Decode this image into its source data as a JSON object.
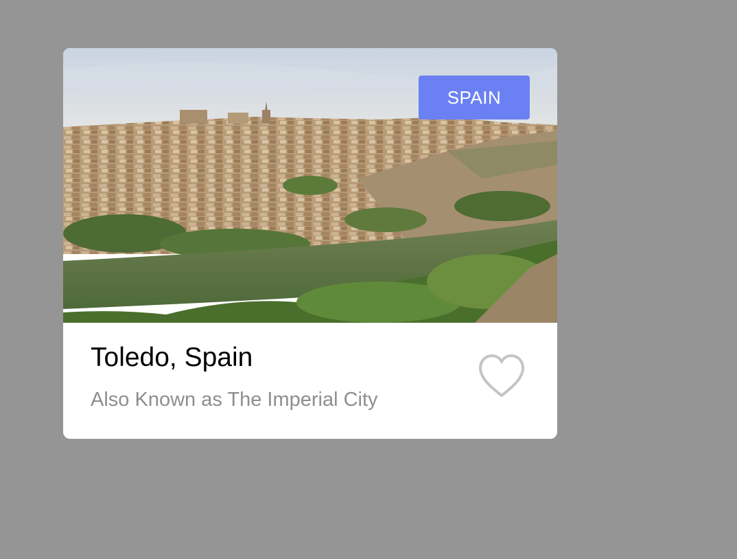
{
  "card": {
    "badge": "SPAIN",
    "title": "Toledo, Spain",
    "subtitle": "Also Known as The Imperial City",
    "favorite_icon": "heart-outline-icon",
    "image_subject": "Aerial view of Toledo over the Tagus river"
  },
  "colors": {
    "page_background": "#959595",
    "card_background": "#ffffff",
    "badge_background": "#6b80f2",
    "badge_text": "#ffffff",
    "title": "#000000",
    "subtitle": "#8e8e8e",
    "heart_stroke": "#c4c4c4"
  }
}
